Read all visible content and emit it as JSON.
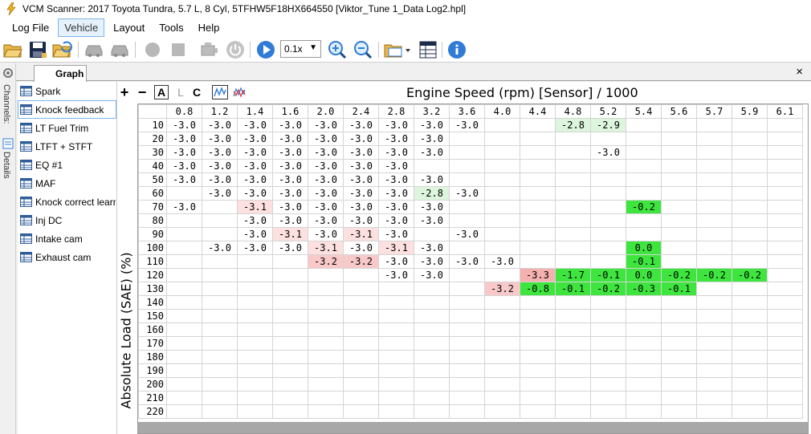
{
  "window": {
    "title": "VCM Scanner: 2017 Toyota Tundra, 5.7 L, 8 Cyl, 5TFHW5F18HX664550 [Viktor_Tune 1_Data Log2.hpl]"
  },
  "menu": [
    {
      "label": "Log File",
      "active": false
    },
    {
      "label": "Vehicle",
      "active": true
    },
    {
      "label": "Layout",
      "active": false
    },
    {
      "label": "Tools",
      "active": false
    },
    {
      "label": "Help",
      "active": false
    }
  ],
  "toolbar": {
    "zoom_value": "0.1x"
  },
  "side_strip": {
    "channels_label": "Channels:",
    "details_label": "Details"
  },
  "tabs": {
    "active_label": "Graph",
    "close_label": "×"
  },
  "channels": [
    {
      "label": "Spark",
      "selected": false
    },
    {
      "label": "Knock feedback",
      "selected": true
    },
    {
      "label": "LT Fuel Trim",
      "selected": false
    },
    {
      "label": "LTFT + STFT",
      "selected": false
    },
    {
      "label": "EQ #1",
      "selected": false
    },
    {
      "label": "MAF",
      "selected": false
    },
    {
      "label": "Knock correct learn",
      "selected": false
    },
    {
      "label": "Inj DC",
      "selected": false
    },
    {
      "label": "Intake cam",
      "selected": false
    },
    {
      "label": "Exhaust cam",
      "selected": false
    }
  ],
  "table_toolbar": {
    "plus": "+",
    "minus": "−",
    "a": "A",
    "l": "L",
    "c": "C"
  },
  "x_axis_title": "Engine Speed (rpm) [Sensor] / 1000",
  "y_axis_title": "Absolute Load (SAE) (%)",
  "columns": [
    "0.8",
    "1.2",
    "1.4",
    "1.6",
    "2.0",
    "2.4",
    "2.8",
    "3.2",
    "3.6",
    "4.0",
    "4.4",
    "4.8",
    "5.2",
    "5.4",
    "5.6",
    "5.7",
    "5.9",
    "6.1"
  ],
  "rows": [
    "10",
    "20",
    "30",
    "40",
    "50",
    "60",
    "70",
    "80",
    "90",
    "100",
    "110",
    "120",
    "130",
    "140",
    "150",
    "160",
    "170",
    "180",
    "190",
    "200",
    "210",
    "220"
  ],
  "cells": [
    [
      "-3.0",
      "-3.0",
      "-3.0",
      "-3.0",
      "-3.0",
      "-3.0",
      "-3.0",
      "-3.0",
      "-3.0",
      "",
      "",
      "-2.8",
      "-2.9",
      "",
      "",
      "",
      "",
      ""
    ],
    [
      "-3.0",
      "-3.0",
      "-3.0",
      "-3.0",
      "-3.0",
      "-3.0",
      "-3.0",
      "-3.0",
      "",
      "",
      "",
      "",
      "",
      "",
      "",
      "",
      "",
      ""
    ],
    [
      "-3.0",
      "-3.0",
      "-3.0",
      "-3.0",
      "-3.0",
      "-3.0",
      "-3.0",
      "-3.0",
      "",
      "",
      "",
      "",
      "-3.0",
      "",
      "",
      "",
      "",
      ""
    ],
    [
      "-3.0",
      "-3.0",
      "-3.0",
      "-3.0",
      "-3.0",
      "-3.0",
      "-3.0",
      "",
      "",
      "",
      "",
      "",
      "",
      "",
      "",
      "",
      "",
      ""
    ],
    [
      "-3.0",
      "-3.0",
      "-3.0",
      "-3.0",
      "-3.0",
      "-3.0",
      "-3.0",
      "-3.0",
      "",
      "",
      "",
      "",
      "",
      "",
      "",
      "",
      "",
      ""
    ],
    [
      "",
      "-3.0",
      "-3.0",
      "-3.0",
      "-3.0",
      "-3.0",
      "-3.0",
      "-2.8",
      "-3.0",
      "",
      "",
      "",
      "",
      "",
      "",
      "",
      "",
      ""
    ],
    [
      "-3.0",
      "",
      "-3.1",
      "-3.0",
      "-3.0",
      "-3.0",
      "-3.0",
      "-3.0",
      "",
      "",
      "",
      "",
      "",
      "-0.2",
      "",
      "",
      "",
      ""
    ],
    [
      "",
      "",
      "-3.0",
      "-3.0",
      "-3.0",
      "-3.0",
      "-3.0",
      "-3.0",
      "",
      "",
      "",
      "",
      "",
      "",
      "",
      "",
      "",
      ""
    ],
    [
      "",
      "",
      "-3.0",
      "-3.1",
      "-3.0",
      "-3.1",
      "-3.0",
      "",
      "-3.0",
      "",
      "",
      "",
      "",
      "",
      "",
      "",
      "",
      ""
    ],
    [
      "",
      "-3.0",
      "-3.0",
      "-3.0",
      "-3.1",
      "-3.0",
      "-3.1",
      "-3.0",
      "",
      "",
      "",
      "",
      "",
      "0.0",
      "",
      "",
      "",
      ""
    ],
    [
      "",
      "",
      "",
      "",
      "-3.2",
      "-3.2",
      "-3.0",
      "-3.0",
      "-3.0",
      "-3.0",
      "",
      "",
      "",
      "-0.1",
      "",
      "",
      "",
      ""
    ],
    [
      "",
      "",
      "",
      "",
      "",
      "",
      "-3.0",
      "-3.0",
      "",
      "",
      "-3.3",
      "-1.7",
      "-0.1",
      "0.0",
      "-0.2",
      "-0.2",
      "-0.2",
      ""
    ],
    [
      "",
      "",
      "",
      "",
      "",
      "",
      "",
      "",
      "",
      "-3.2",
      "-0.8",
      "-0.1",
      "-0.2",
      "-0.3",
      "-0.1",
      "",
      "",
      ""
    ],
    [
      "",
      "",
      "",
      "",
      "",
      "",
      "",
      "",
      "",
      "",
      "",
      "",
      "",
      "",
      "",
      "",
      "",
      ""
    ],
    [
      "",
      "",
      "",
      "",
      "",
      "",
      "",
      "",
      "",
      "",
      "",
      "",
      "",
      "",
      "",
      "",
      "",
      ""
    ],
    [
      "",
      "",
      "",
      "",
      "",
      "",
      "",
      "",
      "",
      "",
      "",
      "",
      "",
      "",
      "",
      "",
      "",
      ""
    ],
    [
      "",
      "",
      "",
      "",
      "",
      "",
      "",
      "",
      "",
      "",
      "",
      "",
      "",
      "",
      "",
      "",
      "",
      ""
    ],
    [
      "",
      "",
      "",
      "",
      "",
      "",
      "",
      "",
      "",
      "",
      "",
      "",
      "",
      "",
      "",
      "",
      "",
      ""
    ],
    [
      "",
      "",
      "",
      "",
      "",
      "",
      "",
      "",
      "",
      "",
      "",
      "",
      "",
      "",
      "",
      "",
      "",
      ""
    ],
    [
      "",
      "",
      "",
      "",
      "",
      "",
      "",
      "",
      "",
      "",
      "",
      "",
      "",
      "",
      "",
      "",
      "",
      ""
    ],
    [
      "",
      "",
      "",
      "",
      "",
      "",
      "",
      "",
      "",
      "",
      "",
      "",
      "",
      "",
      "",
      "",
      "",
      ""
    ],
    [
      "",
      "",
      "",
      "",
      "",
      "",
      "",
      "",
      "",
      "",
      "",
      "",
      "",
      "",
      "",
      "",
      "",
      ""
    ]
  ],
  "colors": {
    "pale_red": "#fde0e0",
    "light_red": "#f9c9c9",
    "red": "#f5b0b0",
    "bright_green": "#3ee53e",
    "pale_green": "#dcf5dc",
    "accent_blue": "#2f7bd6"
  }
}
